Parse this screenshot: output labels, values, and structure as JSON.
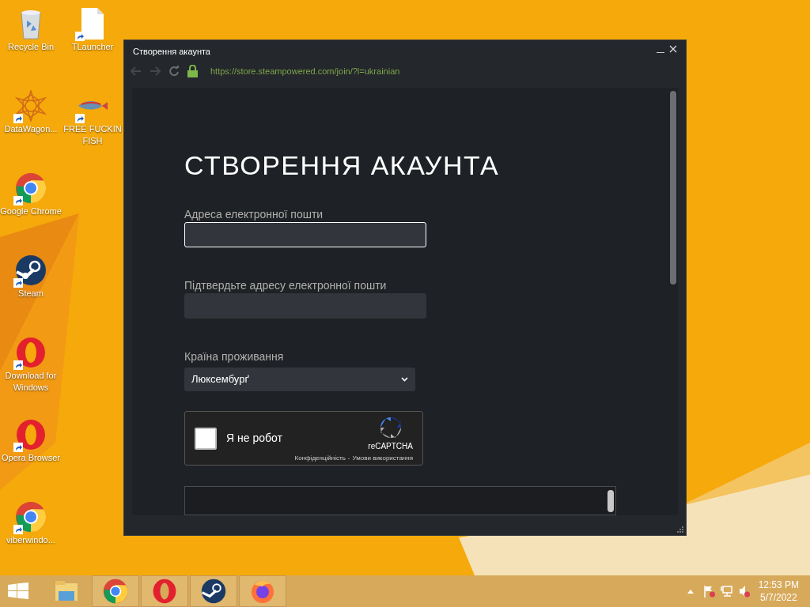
{
  "desktop_icons": [
    {
      "label": "Recycle Bin",
      "shortcut": false
    },
    {
      "label": "DataWagon...",
      "shortcut": true
    },
    {
      "label": "Google Chrome",
      "shortcut": true
    },
    {
      "label": "Steam",
      "shortcut": true
    },
    {
      "label": "Download for Windows",
      "shortcut": true
    },
    {
      "label": "Opera Browser",
      "shortcut": true
    },
    {
      "label": "viberwindo...",
      "shortcut": true
    },
    {
      "label": "TLauncher",
      "shortcut": true
    },
    {
      "label": "FREE FUCKIN FISH",
      "shortcut": true
    }
  ],
  "window": {
    "title": "Створення акаунта",
    "url": "https://store.steampowered.com/join/?l=ukrainian",
    "page": {
      "heading": "СТВОРЕННЯ АКАУНТА",
      "fields": [
        {
          "kind": "text",
          "label": "Адреса електронної пошти",
          "focused": true
        },
        {
          "kind": "text",
          "label": "Підтвердьте адресу електронної пошти",
          "focused": false
        },
        {
          "kind": "select",
          "label": "Країна проживання",
          "value": "Люксембурґ"
        }
      ],
      "captcha": {
        "label": "Я не робот",
        "checked": false,
        "brand": "reCAPTCHA",
        "links": [
          "Конфіденційність",
          "Умови використання"
        ],
        "separator": "-"
      }
    }
  },
  "taskbar": {
    "apps": [
      {
        "running": false
      },
      {
        "running": true
      },
      {
        "running": true
      },
      {
        "running": true
      },
      {
        "running": true
      }
    ],
    "clock": {
      "time": "12:53 PM",
      "date": "5/7/2022"
    }
  }
}
